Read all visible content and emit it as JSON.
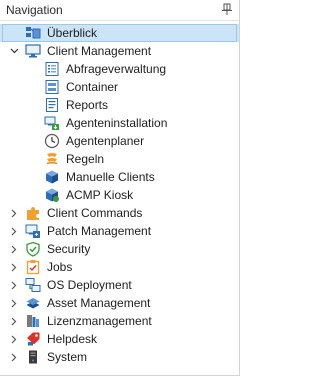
{
  "panel": {
    "title": "Navigation"
  },
  "tree": {
    "overview": {
      "label": "Überblick"
    },
    "client_management": {
      "label": "Client Management",
      "children": [
        {
          "label": "Abfrageverwaltung"
        },
        {
          "label": "Container"
        },
        {
          "label": "Reports"
        },
        {
          "label": "Agenteninstallation"
        },
        {
          "label": "Agentenplaner"
        },
        {
          "label": "Regeln"
        },
        {
          "label": "Manuelle Clients"
        },
        {
          "label": "ACMP Kiosk"
        }
      ]
    },
    "nodes": [
      {
        "label": "Client Commands"
      },
      {
        "label": "Patch Management"
      },
      {
        "label": "Security"
      },
      {
        "label": "Jobs"
      },
      {
        "label": "OS Deployment"
      },
      {
        "label": "Asset Management"
      },
      {
        "label": "Lizenzmanagement"
      },
      {
        "label": "Helpdesk"
      },
      {
        "label": "System"
      }
    ]
  },
  "colors": {
    "selection": "#cce4f7",
    "selection_border": "#99c9ef",
    "icon_blue": "#2f6db5",
    "icon_orange": "#f0a030",
    "icon_green": "#3c9a3c",
    "icon_red": "#d9342b"
  }
}
